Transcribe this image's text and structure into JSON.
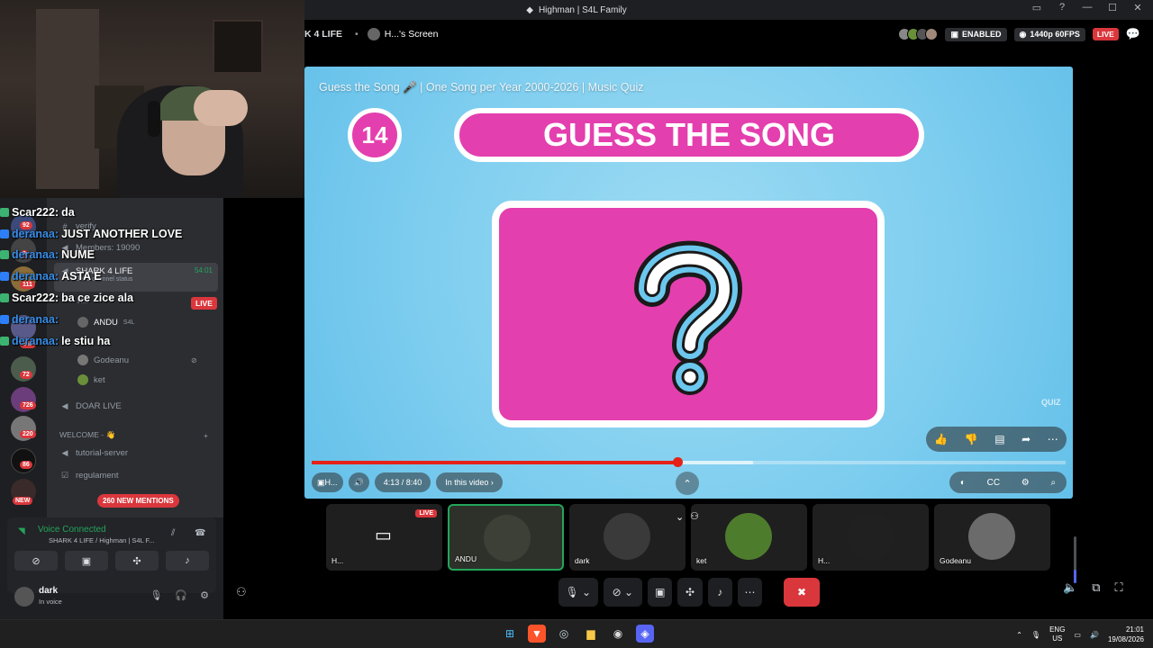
{
  "window": {
    "title": "Highman | S4L Family",
    "controls": [
      "▭",
      "?",
      "—",
      "☐",
      "✕"
    ]
  },
  "stream": {
    "channel": "K 4 LIFE",
    "separator": "•",
    "screen_name": "H...'s Screen",
    "enabled_label": "ENABLED",
    "quality_label": "1440p 60FPS",
    "live_label": "LIVE"
  },
  "chat_overlay": [
    {
      "name": "Scar222:",
      "message": "da",
      "name_color": "#ffffff"
    },
    {
      "name": "deranaa:",
      "message": "JUST ANOTHER LOVE",
      "name_color": "#3a8ee6"
    },
    {
      "name": "deranaa:",
      "message": "NUME",
      "name_color": "#3a8ee6"
    },
    {
      "name": "deranaa:",
      "message": "ASTA E",
      "name_color": "#3a8ee6"
    },
    {
      "name": "Scar222:",
      "message": "ba ce zice ala",
      "name_color": "#ffffff"
    },
    {
      "name": "deranaa:",
      "message": "",
      "name_color": "#3a8ee6"
    },
    {
      "name": "deranaa:",
      "message": "le stiu ha",
      "name_color": "#3a8ee6"
    }
  ],
  "servers": {
    "badges": [
      "92",
      "3",
      "111",
      "260",
      "72",
      "726",
      "220",
      "86",
      "NEW"
    ]
  },
  "channels": {
    "verify": "verify",
    "members": "Members: 19090",
    "active_channel": "SHARK 4 LIFE",
    "active_time": "54:01",
    "status_hint": "Set a channel status",
    "user_h": "H...",
    "live_badge": "LIVE",
    "voice_users": [
      {
        "name": "ANDU",
        "tag": "S4L"
      },
      {
        "name": "Godeanu",
        "tag": ""
      },
      {
        "name": "ket",
        "tag": ""
      }
    ],
    "doar_live": "DOAR LIVE",
    "category": "WELCOME - 👋",
    "tutorial": "tutorial-server",
    "regulament": "regulament",
    "new_mentions": "260 NEW MENTIONS"
  },
  "voice": {
    "status": "Voice Connected",
    "location": "SHARK 4 LIFE / Highman | S4L F..."
  },
  "user": {
    "name": "dark",
    "status": "In voice"
  },
  "video": {
    "title": "Guess the Song 🎤 | One Song per Year 2000-2026 | Music Quiz",
    "round_number": "14",
    "banner_text": "GUESS THE SONG",
    "card_symbol": "?",
    "watermark": "QUIZ",
    "time_label": "4:13 / 8:40",
    "in_video_label": "In this video",
    "progress": 0.485,
    "buffered": 0.585,
    "small_label": "H..."
  },
  "participants": [
    {
      "label": "H...",
      "live": "LIVE",
      "kind": "screen",
      "color": "#1f1f1f"
    },
    {
      "label": "ANDU",
      "kind": "camera",
      "color": "#3c4037",
      "speaking": true
    },
    {
      "label": "dark",
      "kind": "avatar",
      "color": "#3a3a3a"
    },
    {
      "label": "ket",
      "kind": "avatar",
      "color": "#4e7c2d"
    },
    {
      "label": "H...",
      "kind": "avatar",
      "color": "#202020"
    },
    {
      "label": "Godeanu",
      "kind": "avatar",
      "color": "#6b6b6b"
    }
  ],
  "taskbar": {
    "lang": "ENG",
    "region": "US",
    "time": "21:01",
    "date": "19/08/2026"
  },
  "colors": {
    "quiz_pink": "#e43fae",
    "quiz_blue": "#7dcdef",
    "discord_green": "#23a55a",
    "discord_red": "#da373c",
    "blurple": "#5865f2"
  },
  "volume_level": 0.28
}
